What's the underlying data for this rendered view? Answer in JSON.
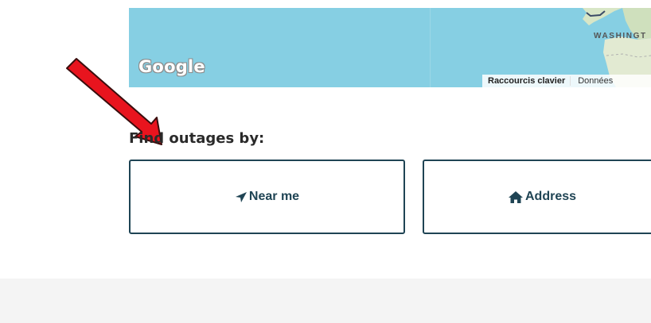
{
  "map": {
    "region_label": "WASHINGT",
    "logo_text": "Google",
    "attribution_shortcuts": "Raccourcis clavier",
    "attribution_data": "Données"
  },
  "section": {
    "heading": "Find outages by:"
  },
  "options": {
    "near_me_label": "Near me",
    "address_label": "Address"
  },
  "colors": {
    "water": "#86cfe3",
    "button_border": "#1f4454",
    "annotation_arrow": "#e8141e"
  },
  "icons": {
    "near_me": "location-arrow-icon",
    "address": "home-icon"
  }
}
